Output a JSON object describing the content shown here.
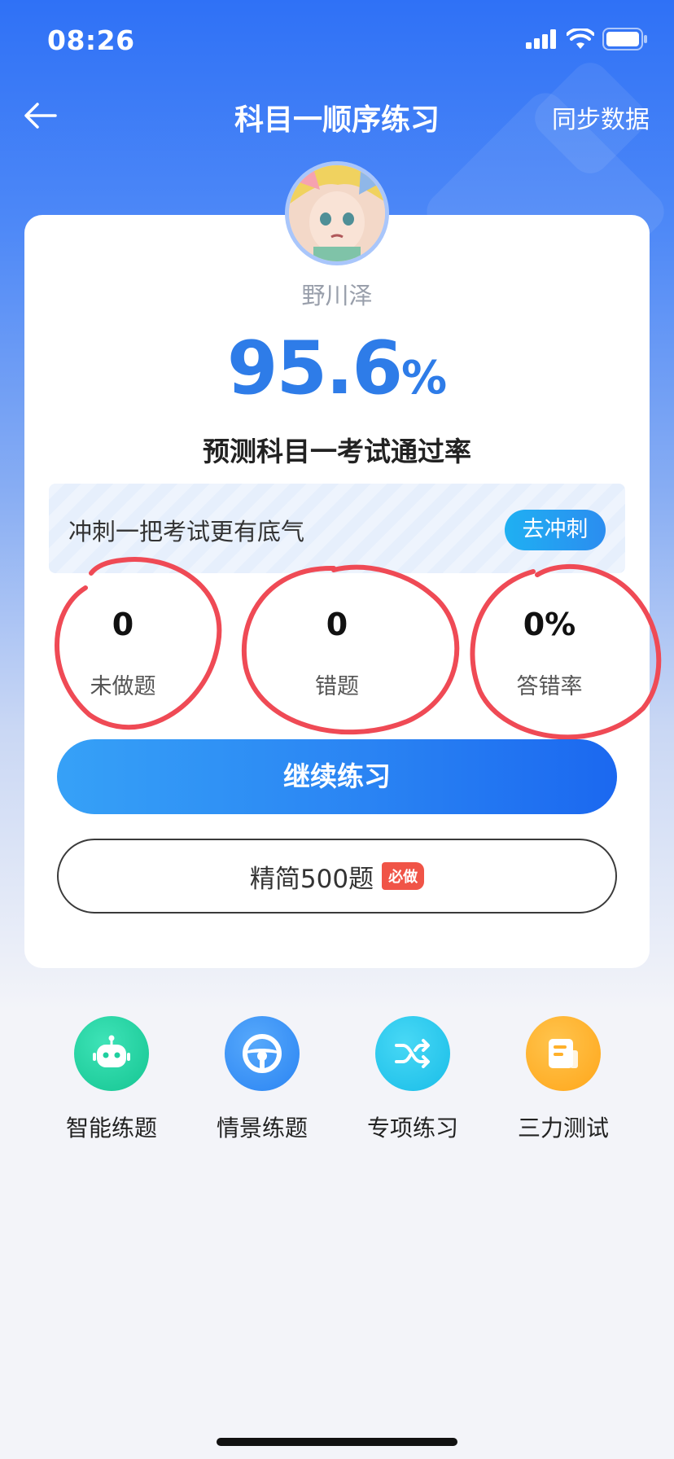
{
  "status_bar": {
    "time": "08:26"
  },
  "nav": {
    "title": "科目一顺序练习",
    "sync_label": "同步数据"
  },
  "profile": {
    "username": "野川泽"
  },
  "prediction": {
    "rate_value": "95.6",
    "rate_unit": "%",
    "label": "预测科目一考试通过率"
  },
  "banner": {
    "text": "冲刺一把考试更有底气",
    "button_label": "去冲刺"
  },
  "stats": [
    {
      "value": "0",
      "label": "未做题"
    },
    {
      "value": "0",
      "label": "错题"
    },
    {
      "value": "0%",
      "label": "答错率"
    }
  ],
  "actions": {
    "continue_label": "继续练习",
    "simplified_label": "精简500题",
    "must_badge": "必做"
  },
  "tools": [
    {
      "label": "智能练题",
      "icon": "robot-icon",
      "color": "#1fcf9f"
    },
    {
      "label": "情景练题",
      "icon": "steering-wheel-icon",
      "color": "#2f8cf6"
    },
    {
      "label": "专项练习",
      "icon": "shuffle-icon",
      "color": "#21c3ea"
    },
    {
      "label": "三力测试",
      "icon": "document-icon",
      "color": "#ffb02a"
    }
  ],
  "colors": {
    "primary": "#2a84f3",
    "rate_blue": "#2e7ce8",
    "annotation_red": "#ef4a55",
    "badge_red": "#f05447"
  }
}
